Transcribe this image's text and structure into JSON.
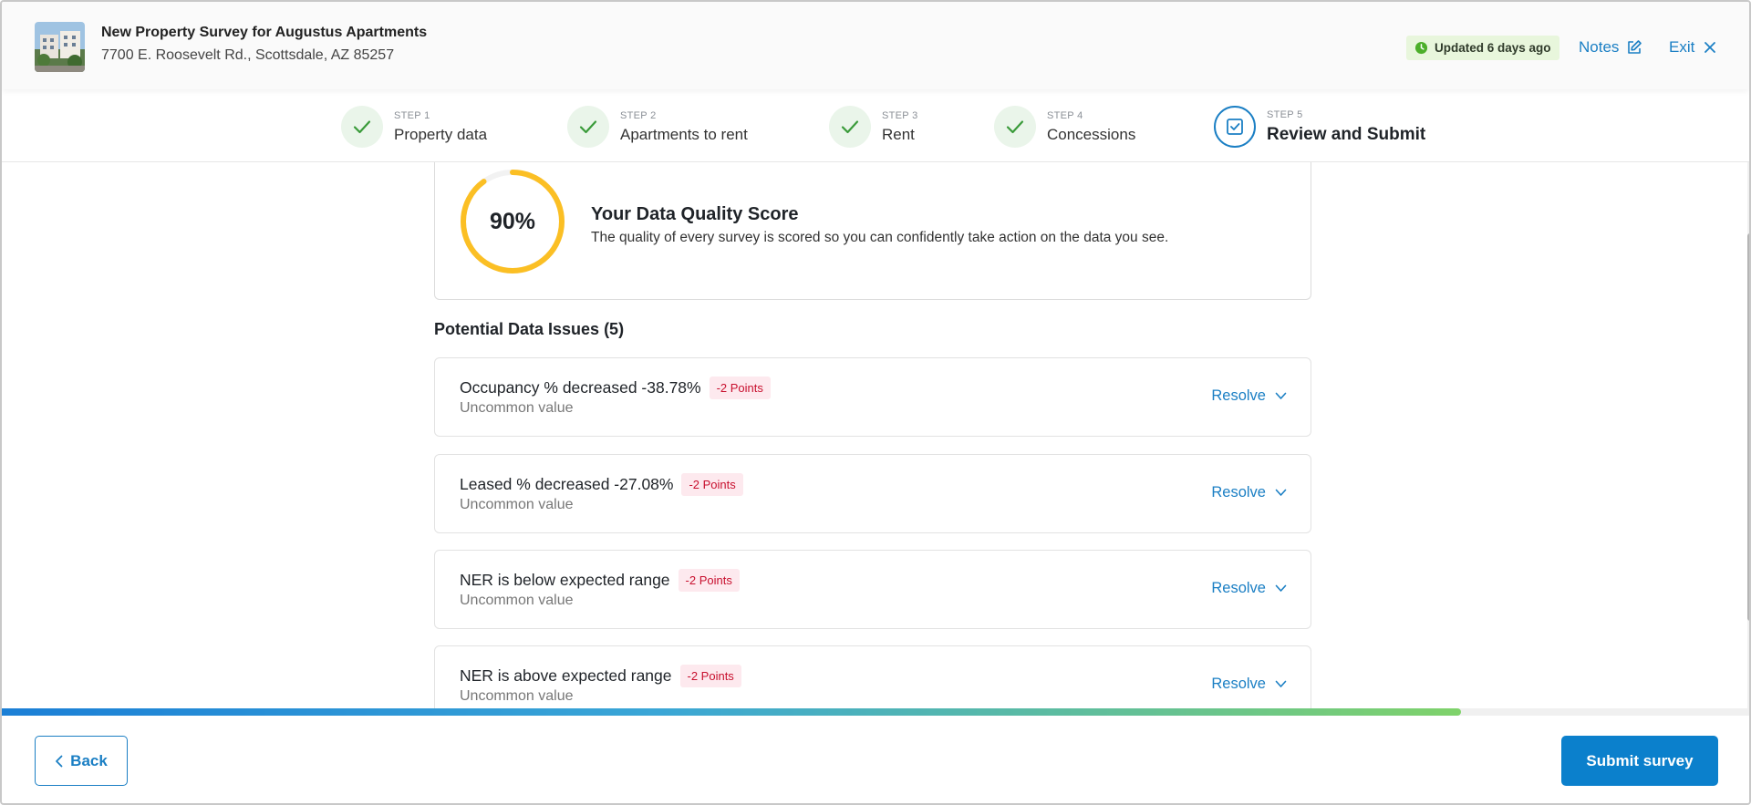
{
  "header": {
    "title": "New Property Survey for Augustus Apartments",
    "address": "7700 E. Roosevelt Rd., Scottsdale, AZ 85257",
    "updated": "Updated 6 days ago",
    "notes_label": "Notes",
    "exit_label": "Exit"
  },
  "steps": [
    {
      "num": "STEP 1",
      "label": "Property data",
      "state": "complete"
    },
    {
      "num": "STEP 2",
      "label": "Apartments to rent",
      "state": "complete"
    },
    {
      "num": "STEP 3",
      "label": "Rent",
      "state": "complete"
    },
    {
      "num": "STEP 4",
      "label": "Concessions",
      "state": "complete"
    },
    {
      "num": "STEP 5",
      "label": "Review and Submit",
      "state": "active"
    }
  ],
  "score": {
    "value_text": "90%",
    "value": 0.9,
    "title": "Your Data Quality Score",
    "description": "The quality of every survey is scored so you can confidently take action on the data you see."
  },
  "issues_heading": "Potential Data Issues (5)",
  "issues": [
    {
      "title": "Occupancy % decreased -38.78%",
      "points": "-2 Points",
      "subtitle": "Uncommon value",
      "action": "Resolve"
    },
    {
      "title": "Leased % decreased -27.08%",
      "points": "-2 Points",
      "subtitle": "Uncommon value",
      "action": "Resolve"
    },
    {
      "title": "NER is below expected range",
      "points": "-2 Points",
      "subtitle": "Uncommon value",
      "action": "Resolve"
    },
    {
      "title": "NER is above expected range",
      "points": "-2 Points",
      "subtitle": "Uncommon value",
      "action": "Resolve"
    }
  ],
  "progress": 0.835,
  "footer": {
    "back_label": "Back",
    "submit_label": "Submit survey"
  },
  "colors": {
    "accent": "#1b7fc4",
    "gauge": "#fbbf24",
    "badge_bg": "#fde9ee",
    "badge_text": "#c8102e",
    "updated_bg": "#e8f6dc",
    "updated_icon": "#4caf2a",
    "step_check": "#3a9b3a"
  }
}
